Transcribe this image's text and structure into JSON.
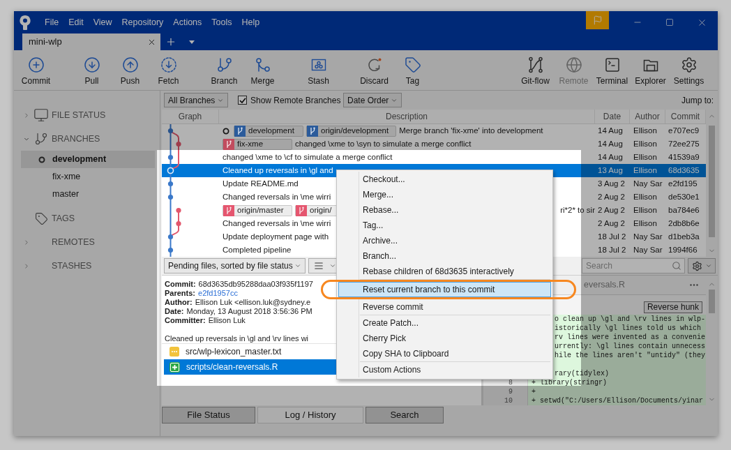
{
  "menu_bar": [
    "File",
    "Edit",
    "View",
    "Repository",
    "Actions",
    "Tools",
    "Help"
  ],
  "tabs": [
    {
      "label": "mini-wlp",
      "selected": true
    }
  ],
  "toolbar": {
    "left": [
      {
        "label": "Commit",
        "disabled": false
      },
      {
        "label": "Pull",
        "disabled": false
      },
      {
        "label": "Push",
        "disabled": false
      },
      {
        "label": "Fetch",
        "disabled": false
      },
      {
        "label": "Branch",
        "disabled": false
      },
      {
        "label": "Merge",
        "disabled": false
      },
      {
        "label": "Stash",
        "disabled": false
      },
      {
        "label": "Discard",
        "disabled": false
      },
      {
        "label": "Tag",
        "disabled": false
      }
    ],
    "right": [
      {
        "label": "Git-flow",
        "disabled": false
      },
      {
        "label": "Remote",
        "disabled": true
      },
      {
        "label": "Terminal",
        "disabled": false
      },
      {
        "label": "Explorer",
        "disabled": false
      },
      {
        "label": "Settings",
        "disabled": false
      }
    ]
  },
  "sidebar": {
    "sections": [
      {
        "label": "FILE STATUS",
        "expanded": false
      },
      {
        "label": "BRANCHES",
        "expanded": true,
        "children": [
          {
            "label": "development",
            "selected": true,
            "current": true
          },
          {
            "label": "fix-xme",
            "selected": false,
            "current": false
          },
          {
            "label": "master",
            "selected": false,
            "current": false
          }
        ]
      },
      {
        "label": "TAGS"
      },
      {
        "label": "REMOTES",
        "expanded": false
      },
      {
        "label": "STASHES",
        "expanded": false
      }
    ]
  },
  "log_filters": {
    "branches": "All Branches",
    "show_remote_branches": {
      "label": "Show Remote Branches",
      "checked": true
    },
    "order": "Date Order",
    "jump_to": "Jump to:"
  },
  "commit_table": {
    "columns": [
      "Graph",
      "Description",
      "Date",
      "Author",
      "Commit"
    ],
    "rows": [
      {
        "head": true,
        "refs": [
          {
            "label": "development",
            "color": "#2b5b9b"
          },
          {
            "label": "origin/development",
            "color": "#2b5b9b"
          }
        ],
        "description": "Merge branch 'fix-xme' into development",
        "date": "14 Aug",
        "author": "Ellison",
        "commit": "e707ec9",
        "selected": false
      },
      {
        "head": false,
        "refs": [
          {
            "label": "fix-xme",
            "color": "#c14c5e"
          }
        ],
        "description": "changed \\xme to \\syn to simulate a merge conflict",
        "date": "14 Aug",
        "author": "Ellison",
        "commit": "72ee275",
        "selected": false
      },
      {
        "head": false,
        "description": "changed \\xme to \\cf to simulate a merge conflict",
        "date": "14 Aug",
        "author": "Ellison",
        "commit": "41539a9",
        "selected": false
      },
      {
        "head": false,
        "description": "Cleaned up reversals in \\gl and",
        "date": "13 Aug",
        "author": "Ellison",
        "commit": "68d3635",
        "selected": true
      },
      {
        "head": false,
        "description": "Update README.md",
        "date": "3 Aug 2",
        "author": "Nay Sar",
        "commit": "e2fd195",
        "selected": false
      },
      {
        "head": false,
        "description": "Changed reversals in \\me wirri",
        "date": "2 Aug 2",
        "author": "Ellison",
        "commit": "de530e1",
        "selected": false
      },
      {
        "head": false,
        "refs": [
          {
            "label": "origin/master",
            "color": "#e5566f"
          },
          {
            "label": "origin/",
            "color": "#e5566f"
          }
        ],
        "description_end": "ri*2* to sir",
        "date": "2 Aug 2",
        "author": "Ellison",
        "commit": "ba784e6",
        "selected": false
      },
      {
        "head": false,
        "description": "Changed reversals in \\me wirri",
        "date": "2 Aug 2",
        "author": "Ellison",
        "commit": "2db8b6e",
        "selected": false
      },
      {
        "head": false,
        "description": "Update deployment page with",
        "date": "18 Jul 2",
        "author": "Nay Sar",
        "commit": "d1beb3a",
        "selected": false
      },
      {
        "head": false,
        "description": "Completed pipeline",
        "date": "18 Jul 2",
        "author": "Nay Sar",
        "commit": "1994f66",
        "selected": false
      }
    ]
  },
  "file_toolbar": {
    "view": "Pending files, sorted by file status",
    "search": {
      "placeholder": "Search"
    }
  },
  "commit_details": {
    "fields": [
      {
        "label": "Commit:",
        "value": "68d3635db95288daa03f935f1197",
        "kind": "text"
      },
      {
        "label": "Parents:",
        "value": "e2fd1957cc",
        "kind": "link"
      },
      {
        "label": "Author:",
        "value": "Ellison Luk <ellison.luk@sydney.e",
        "kind": "text"
      },
      {
        "label": "Date:",
        "value": "Monday, 13 August 2018 3:56:36 PM",
        "kind": "text"
      },
      {
        "label": "Committer:",
        "value": "Ellison Luk",
        "kind": "text"
      }
    ],
    "message": "Cleaned up reversals in \\gl and \\rv lines wi",
    "files": [
      {
        "path": "src/wlp-lexicon_master.txt",
        "kind": "modified",
        "selected": false
      },
      {
        "path": "scripts/clean-reversals.R",
        "kind": "added",
        "selected": true
      }
    ]
  },
  "diff": {
    "file_name": "eversals.R",
    "reverse_hunk_button": "Reverse hunk",
    "lines": [
      {
        "kind": "partial",
        "text": "o clean up \\gl and \\rv lines in wlp-"
      },
      {
        "kind": "partial",
        "text": "istorically \\gl lines told us which"
      },
      {
        "kind": "partial",
        "text": "rv lines were invented as a convenie"
      },
      {
        "kind": "partial",
        "text": "urrently: \\gl lines contain unnecess"
      },
      {
        "kind": "partial",
        "text": "hile the lines aren't \"untidy\" (they"
      },
      {
        "kind": "blank"
      },
      {
        "kind": "partial",
        "text": "rary(tidylex)"
      },
      {
        "kind": "full",
        "number": "8",
        "text": "+ library(stringr)"
      },
      {
        "kind": "full",
        "number": "9",
        "text": "+"
      },
      {
        "kind": "full",
        "number": "10",
        "text": "+ setwd(\"C:/Users/Ellison/Documents/yinar"
      }
    ]
  },
  "bottom_tabs": [
    {
      "label": "File Status",
      "selected": false
    },
    {
      "label": "Log / History",
      "selected": true
    },
    {
      "label": "Search",
      "selected": false
    }
  ],
  "context_menu": {
    "items": [
      {
        "kind": "item",
        "label": "Checkout...",
        "selected": false,
        "circled": false
      },
      {
        "kind": "item",
        "label": "Merge...",
        "selected": false,
        "circled": false
      },
      {
        "kind": "item",
        "label": "Rebase...",
        "selected": false,
        "circled": false
      },
      {
        "kind": "item",
        "label": "Tag...",
        "selected": false,
        "circled": false
      },
      {
        "kind": "item",
        "label": "Archive...",
        "selected": false,
        "circled": false
      },
      {
        "kind": "item",
        "label": "Branch...",
        "selected": false,
        "circled": false
      },
      {
        "kind": "item",
        "label": "Rebase children of 68d3635 interactively",
        "selected": false,
        "circled": false
      },
      {
        "kind": "separator"
      },
      {
        "kind": "item",
        "label": "Reset current branch to this commit",
        "selected": true,
        "circled": true
      },
      {
        "kind": "item",
        "label": "Reverse commit",
        "selected": false,
        "circled": false
      },
      {
        "kind": "separator"
      },
      {
        "kind": "item",
        "label": "Create Patch...",
        "selected": false,
        "circled": false
      },
      {
        "kind": "item",
        "label": "Cherry Pick",
        "selected": false,
        "circled": false
      },
      {
        "kind": "item",
        "label": "Copy SHA to Clipboard",
        "selected": false,
        "circled": false
      },
      {
        "kind": "separator"
      },
      {
        "kind": "item",
        "label": "Custom Actions",
        "selected": false,
        "circled": false
      }
    ]
  }
}
